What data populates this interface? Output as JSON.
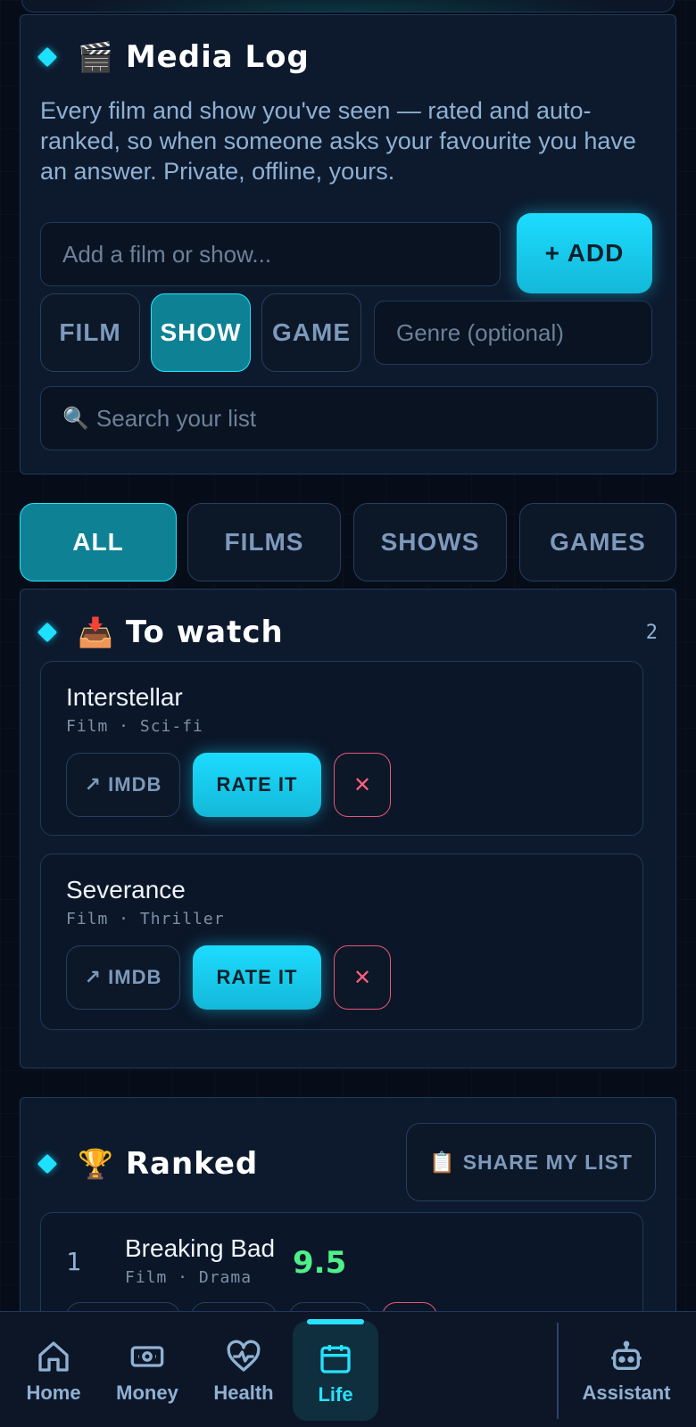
{
  "media_log": {
    "emoji": "🎬",
    "title": "Media Log",
    "description": "Every film and show you've seen — rated and auto-ranked, so when someone asks your favourite you have an answer. Private, offline, yours.",
    "add_placeholder": "Add a film or show...",
    "add_button": "+ ADD",
    "types": [
      "FILM",
      "SHOW",
      "GAME"
    ],
    "selected_type": "SHOW",
    "genre_placeholder": "Genre (optional)",
    "search_icon": "🔍",
    "search_placeholder": "Search your list"
  },
  "filters": {
    "items": [
      "ALL",
      "FILMS",
      "SHOWS",
      "GAMES"
    ],
    "selected": "ALL"
  },
  "to_watch": {
    "emoji": "📥",
    "title": "To watch",
    "count": "2",
    "items": [
      {
        "title": "Interstellar",
        "meta": "Film · Sci-fi",
        "imdb_label": "↗ IMDB",
        "rate_label": "RATE IT",
        "remove_label": "✕"
      },
      {
        "title": "Severance",
        "meta": "Film · Thriller",
        "imdb_label": "↗ IMDB",
        "rate_label": "RATE IT",
        "remove_label": "✕"
      }
    ]
  },
  "ranked": {
    "emoji": "🏆",
    "title": "Ranked",
    "share_icon": "📋",
    "share_label": "SHARE MY LIST",
    "items": [
      {
        "rank": "1",
        "title": "Breaking Bad",
        "meta": "Film · Drama",
        "score": "9.5"
      }
    ]
  },
  "colors": {
    "accent": "#1ee0ff",
    "score": "#4ef08a",
    "danger": "#ff5f7c"
  },
  "nav": {
    "items": [
      {
        "label": "Home",
        "icon": "home-icon"
      },
      {
        "label": "Money",
        "icon": "money-icon"
      },
      {
        "label": "Health",
        "icon": "heart-pulse-icon"
      },
      {
        "label": "Life",
        "icon": "calendar-icon"
      },
      {
        "label": "Assistant",
        "icon": "robot-icon"
      }
    ],
    "active": "Life"
  }
}
